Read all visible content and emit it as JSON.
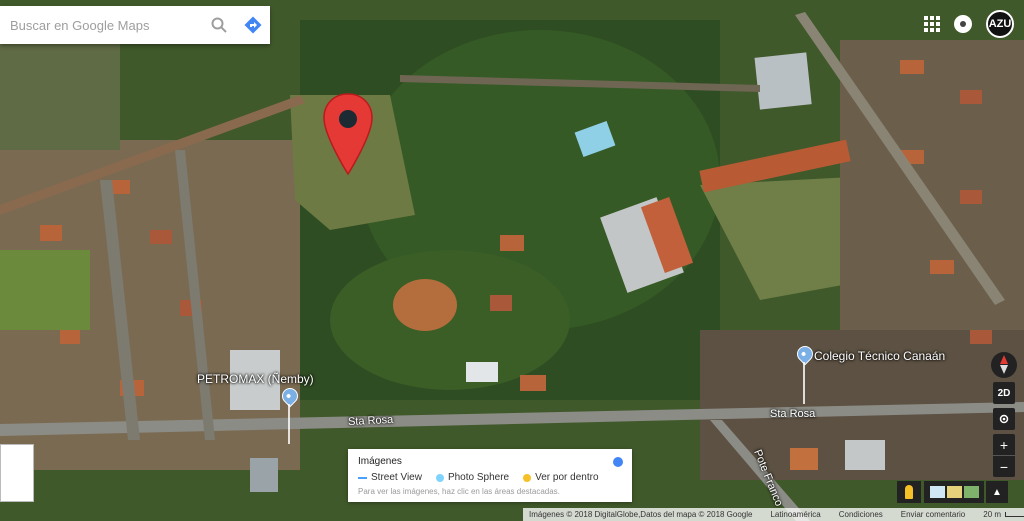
{
  "search": {
    "placeholder": "Buscar en Google Maps",
    "search_icon": "search-icon",
    "directions_icon": "directions-icon"
  },
  "account": {
    "apps_icon": "apps-grid-icon",
    "notifications_icon": "notifications-icon",
    "avatar_text": "AZU"
  },
  "map": {
    "type": "satellite",
    "marker": {
      "icon": "red-pin-icon",
      "color": "#e53935"
    },
    "places": [
      {
        "name": "PETROMAX (Ñemby)",
        "icon": "poi-pin-icon"
      },
      {
        "name": "Colegio Técnico Canaán",
        "icon": "poi-pin-icon"
      }
    ],
    "streets": [
      "Sta Rosa",
      "Sta Rosa",
      "Pote Franco"
    ]
  },
  "imagery_panel": {
    "title": "Imágenes",
    "legend": [
      {
        "label": "Street View",
        "color": "#4aa0ff"
      },
      {
        "label": "Photo Sphere",
        "color": "#7fd3ff"
      },
      {
        "label": "Ver por dentro",
        "color": "#f6c027"
      }
    ],
    "hint": "Para ver las imágenes, haz clic en las áreas destacadas."
  },
  "controls": {
    "compass_icon": "compass-icon",
    "view_mode": "2D",
    "my_location_icon": "my-location-icon",
    "zoom_in": "+",
    "zoom_out": "−",
    "pegman_icon": "pegman-icon",
    "expand_icon": "expand-icon"
  },
  "footer": {
    "attribution": "Imágenes © 2018 DigitalGlobe,Datos del mapa © 2018 Google",
    "region": "Latinoamérica",
    "terms": "Condiciones",
    "feedback": "Enviar comentario",
    "scale": "20 m"
  }
}
